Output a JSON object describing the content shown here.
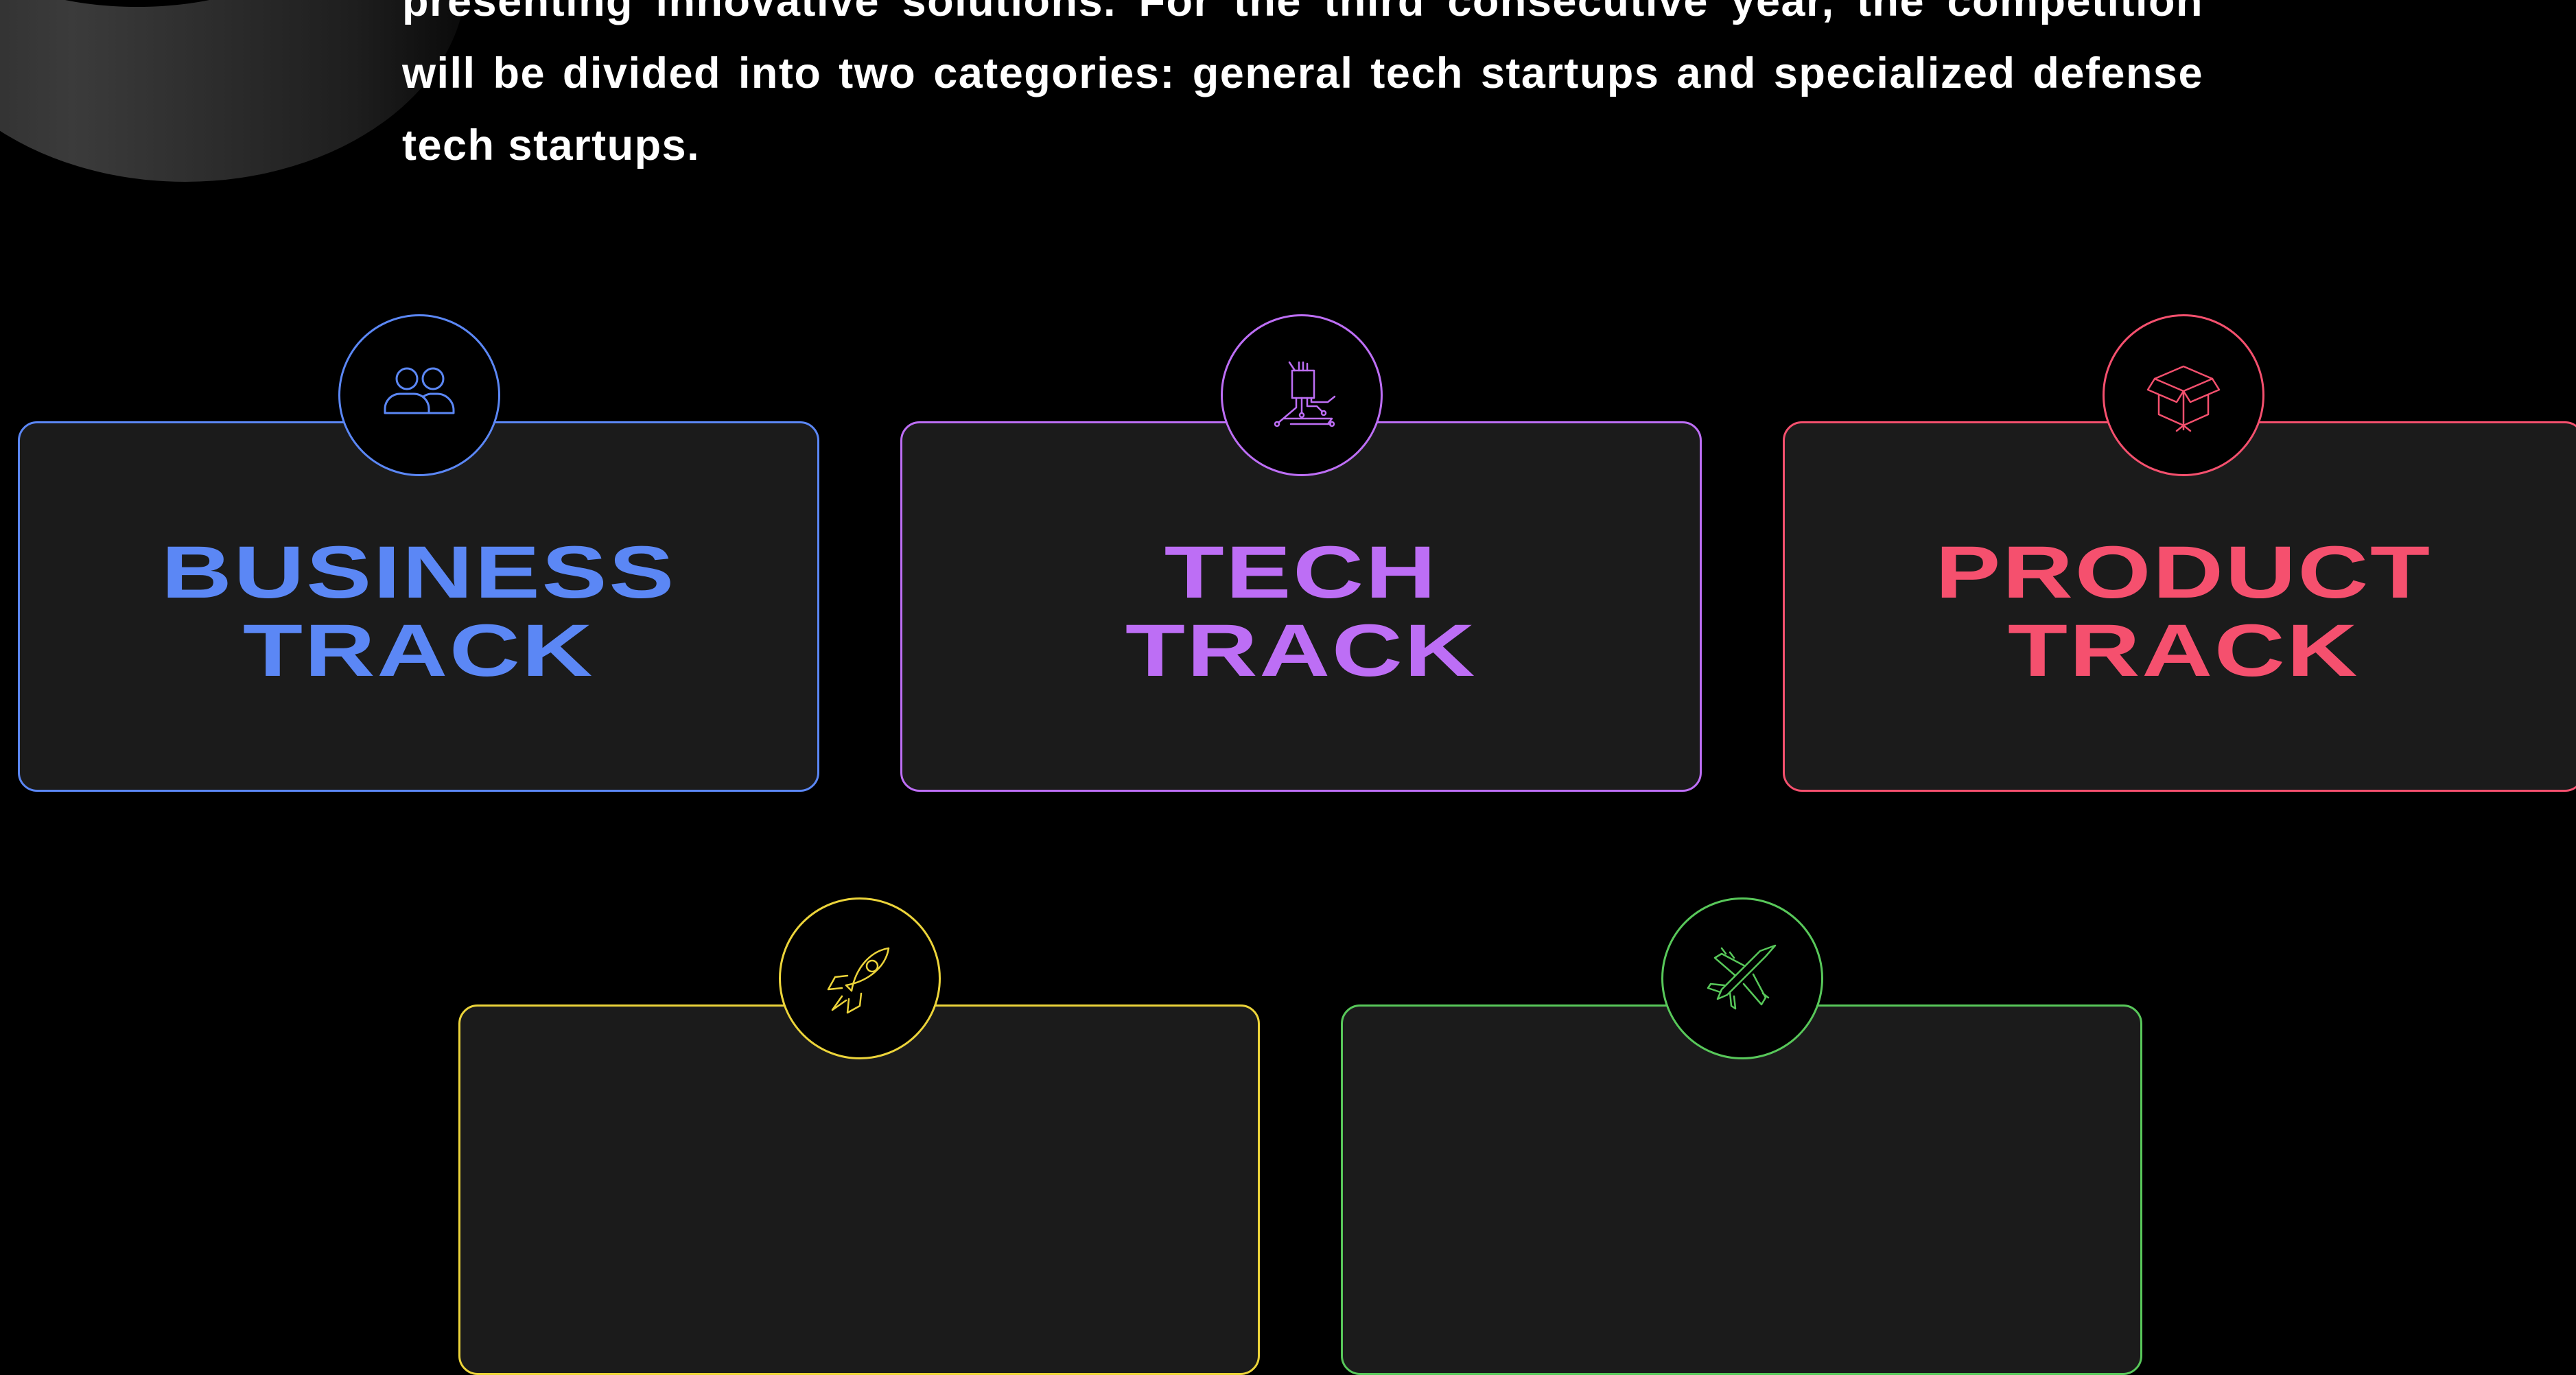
{
  "intro": {
    "text": "presenting innovative solutions. For the third consecutive year, the competition will be divided into two categories: general tech startups and specialized defense tech startups."
  },
  "tracks": [
    {
      "line1": "BUSINESS",
      "line2": "TRACK",
      "icon": "users-icon",
      "color": "#5b87f5"
    },
    {
      "line1": "TECH",
      "line2": "TRACK",
      "icon": "chip-circuit-icon",
      "color": "#bd6ef5"
    },
    {
      "line1": "PRODUCT",
      "line2": "TRACK",
      "icon": "open-box-icon",
      "color": "#f5506e"
    },
    {
      "line1": "",
      "line2": "",
      "icon": "rocket-icon",
      "color": "#ecd43a"
    },
    {
      "line1": "",
      "line2": "",
      "icon": "fighter-jet-icon",
      "color": "#58c85a"
    }
  ],
  "colors": {
    "background": "#000000",
    "card_background": "#1b1b1b",
    "text": "#ffffff"
  }
}
